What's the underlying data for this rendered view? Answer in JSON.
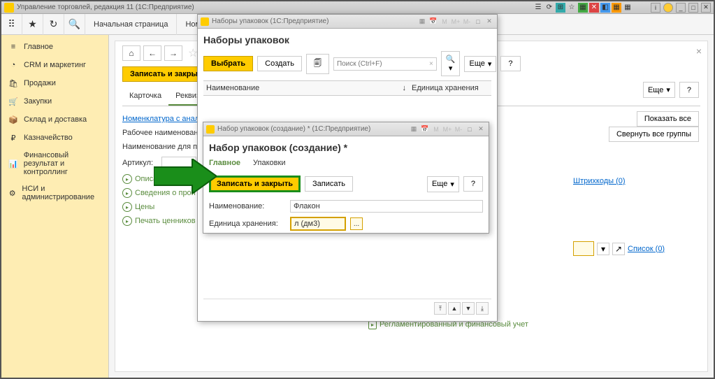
{
  "titlebar": {
    "title": "Управление торговлей, редакция 11  (1С:Предприятие)"
  },
  "top_tabs": {
    "start": "Начальная страница",
    "nomen": "Номенклату"
  },
  "sidebar": {
    "items": [
      {
        "label": "Главное"
      },
      {
        "label": "CRM и маркетинг"
      },
      {
        "label": "Продажи"
      },
      {
        "label": "Закупки"
      },
      {
        "label": "Склад и доставка"
      },
      {
        "label": "Казначейство"
      },
      {
        "label": "Финансовый результат и контроллинг"
      },
      {
        "label": "НСИ и администрирование"
      }
    ]
  },
  "content": {
    "save_close": "Записать и закрыть",
    "eshe": "Еще",
    "show_all": "Показать все",
    "collapse_all": "Свернуть все группы",
    "tabs": {
      "card": "Карточка",
      "req": "Реквизиты"
    },
    "link_analogs": "Номенклатура с аналоги",
    "lbl_work_name": "Рабочее наименование:",
    "lbl_print_name": "Наименование для печат",
    "lbl_article": "Артикул:",
    "green_items": [
      "Описани",
      "Сведения о прои",
      "Цены",
      "Печать ценников"
    ],
    "barcodes": "Штрихкоды (0)",
    "list": "Список (0)",
    "bottom": "Регламентированный и финансовый учет"
  },
  "dialog1": {
    "titlebar": "Наборы упаковок  (1С:Предприятие)",
    "heading": "Наборы упаковок",
    "select": "Выбрать",
    "create": "Создать",
    "search_ph": "Поиск (Ctrl+F)",
    "eshe": "Еще",
    "col_name": "Наименование",
    "col_unit": "Единица хранения"
  },
  "dialog2": {
    "titlebar": "Набор упаковок (создание) *  (1С:Предприятие)",
    "heading": "Набор упаковок (создание) *",
    "tab_main": "Главное",
    "tab_pack": "Упаковки",
    "save_close": "Записать и закрыть",
    "save": "Записать",
    "eshe": "Еще",
    "lbl_name": "Наименование:",
    "val_name": "Флакон",
    "lbl_unit": "Единица хранения:",
    "val_unit": "л (дм3)"
  }
}
